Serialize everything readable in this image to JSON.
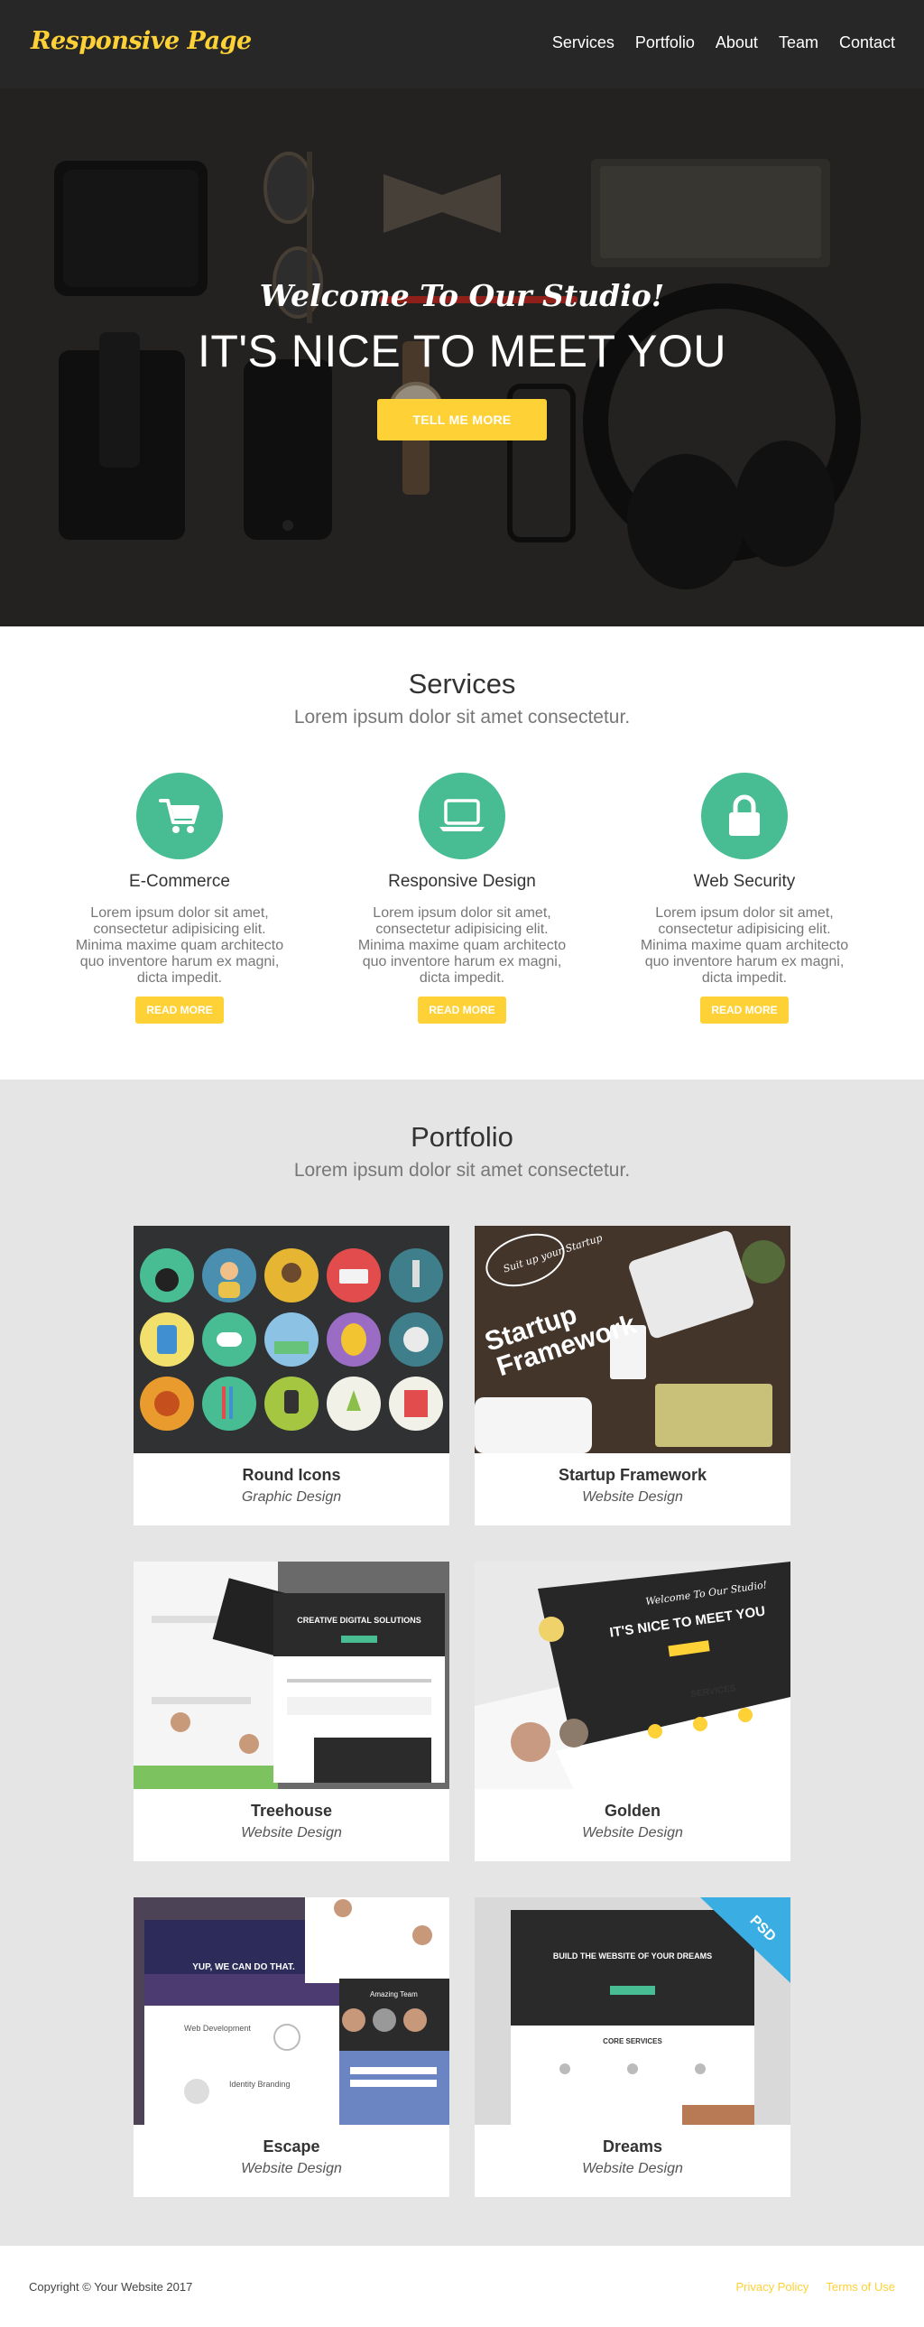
{
  "navbar": {
    "brand": "Responsive Page",
    "links": [
      "Services",
      "Portfolio",
      "About",
      "Team",
      "Contact"
    ]
  },
  "hero": {
    "subheading": "Welcome To Our Studio!",
    "heading": "IT'S NICE TO MEET YOU",
    "button": "TELL ME MORE"
  },
  "services": {
    "heading": "Services",
    "subheading": "Lorem ipsum dolor sit amet consectetur.",
    "items": [
      {
        "title": "E-Commerce",
        "icon": "shopping-cart-icon",
        "text": "Lorem ipsum dolor sit amet, consectetur adipisicing elit. Minima maxime quam architecto quo inventore harum ex magni, dicta impedit.",
        "button": "READ MORE"
      },
      {
        "title": "Responsive Design",
        "icon": "laptop-icon",
        "text": "Lorem ipsum dolor sit amet, consectetur adipisicing elit. Minima maxime quam architecto quo inventore harum ex magni, dicta impedit.",
        "button": "READ MORE"
      },
      {
        "title": "Web Security",
        "icon": "lock-icon",
        "text": "Lorem ipsum dolor sit amet, consectetur adipisicing elit. Minima maxime quam architecto quo inventore harum ex magni, dicta impedit.",
        "button": "READ MORE"
      }
    ]
  },
  "portfolio": {
    "heading": "Portfolio",
    "subheading": "Lorem ipsum dolor sit amet consectetur.",
    "items": [
      {
        "title": "Round Icons",
        "category": "Graphic Design"
      },
      {
        "title": "Startup Framework",
        "category": "Website Design",
        "image_text_1": "Startup",
        "image_text_2": "Framework",
        "badge": "Suit up your Startup"
      },
      {
        "title": "Treehouse",
        "category": "Website Design",
        "image_text": "CREATIVE DIGITAL SOLUTIONS"
      },
      {
        "title": "Golden",
        "category": "Website Design",
        "image_text": "IT'S NICE TO MEET YOU",
        "image_sub": "Welcome To Our Studio!",
        "image_services": "SERVICES"
      },
      {
        "title": "Escape",
        "category": "Website Design",
        "image_text": "YUP, WE CAN DO THAT.",
        "image_dev": "Web Development",
        "image_brand": "Identity Branding",
        "image_team": "Amazing Team"
      },
      {
        "title": "Dreams",
        "category": "Website Design",
        "image_text": "BUILD THE WEBSITE OF YOUR DREAMS",
        "image_core": "CORE SERVICES",
        "ribbon": "PSD"
      }
    ]
  },
  "footer": {
    "copyright": "Copyright © Your Website 2017",
    "links": [
      "Privacy Policy",
      "Terms of Use"
    ]
  },
  "colors": {
    "accent": "#fed136",
    "teal": "#48bd94",
    "navbar": "#272727",
    "portfolio_bg": "#e5e5e5"
  }
}
